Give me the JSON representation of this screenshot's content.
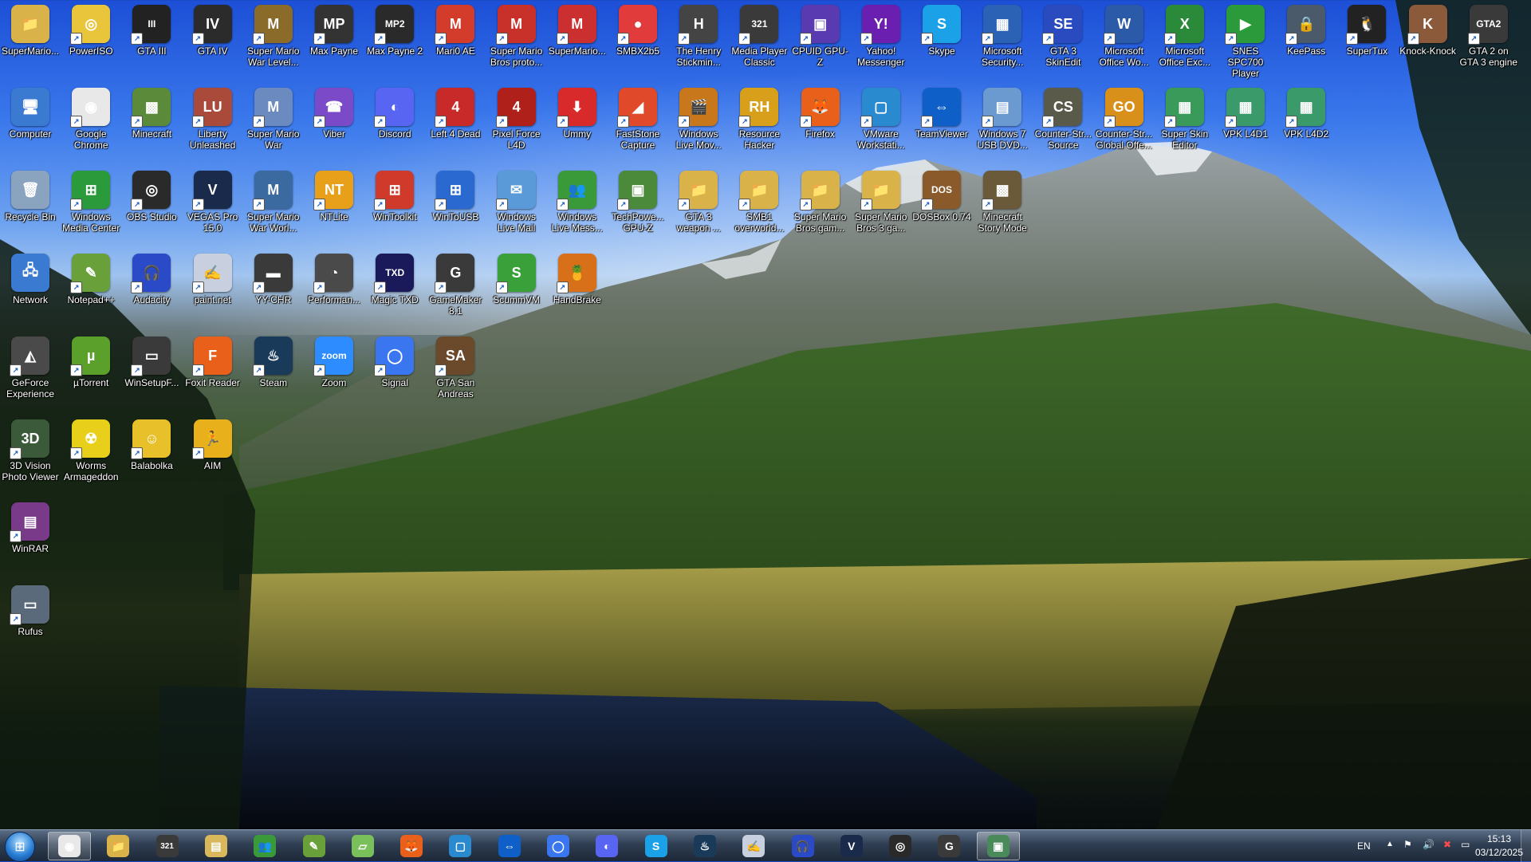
{
  "desktop": {
    "icons": [
      {
        "label": "SuperMario...",
        "icon": "folder-icon",
        "color": "#d9b34a",
        "glyph": "📁",
        "col": 0,
        "row": 0
      },
      {
        "label": "PowerISO",
        "icon": "disc-icon",
        "color": "#e8c53a",
        "glyph": "◎",
        "col": 1,
        "row": 0
      },
      {
        "label": "GTA III",
        "icon": "gta3-icon",
        "color": "#222222",
        "glyph": "III",
        "col": 2,
        "row": 0
      },
      {
        "label": "GTA IV",
        "icon": "gta4-icon",
        "color": "#2b2b2b",
        "glyph": "IV",
        "col": 3,
        "row": 0
      },
      {
        "label": "Super Mario War Level...",
        "icon": "game-icon",
        "color": "#8a6b2a",
        "glyph": "M",
        "col": 4,
        "row": 0
      },
      {
        "label": "Max Payne",
        "icon": "max-payne-icon",
        "color": "#333333",
        "glyph": "MP",
        "col": 5,
        "row": 0
      },
      {
        "label": "Max Payne 2",
        "icon": "max-payne2-icon",
        "color": "#2a2a2a",
        "glyph": "MP2",
        "col": 6,
        "row": 0
      },
      {
        "label": "Mari0 AE",
        "icon": "mario-icon",
        "color": "#d33b2a",
        "glyph": "M",
        "col": 7,
        "row": 0
      },
      {
        "label": "Super Mario Bros proto...",
        "icon": "mario-icon",
        "color": "#c8302a",
        "glyph": "M",
        "col": 8,
        "row": 0
      },
      {
        "label": "SuperMario...",
        "icon": "mario-icon",
        "color": "#cc2f2f",
        "glyph": "M",
        "col": 9,
        "row": 0
      },
      {
        "label": "SMBX2b5",
        "icon": "mushroom-icon",
        "color": "#e23b3b",
        "glyph": "●",
        "col": 10,
        "row": 0
      },
      {
        "label": "The Henry Stickmin...",
        "icon": "henry-icon",
        "color": "#444444",
        "glyph": "H",
        "col": 11,
        "row": 0
      },
      {
        "label": "Media Player Classic",
        "icon": "media-player-icon",
        "color": "#3a3a3a",
        "glyph": "321",
        "col": 12,
        "row": 0
      },
      {
        "label": "CPUID GPU-Z",
        "icon": "cpu-icon",
        "color": "#5a3ab0",
        "glyph": "▣",
        "col": 13,
        "row": 0
      },
      {
        "label": "Yahoo! Messenger",
        "icon": "yahoo-icon",
        "color": "#6a1fb0",
        "glyph": "Y!",
        "col": 14,
        "row": 0
      },
      {
        "label": "Skype",
        "icon": "skype-icon",
        "color": "#1aa1e8",
        "glyph": "S",
        "col": 15,
        "row": 0
      },
      {
        "label": "Microsoft Security...",
        "icon": "security-icon",
        "color": "#2b62b5",
        "glyph": "▦",
        "col": 16,
        "row": 0
      },
      {
        "label": "GTA 3 SkinEdit",
        "icon": "skinedit-icon",
        "color": "#2a4ac0",
        "glyph": "SE",
        "col": 17,
        "row": 0
      },
      {
        "label": "Microsoft Office Wo...",
        "icon": "word-icon",
        "color": "#2b5aa8",
        "glyph": "W",
        "col": 18,
        "row": 0
      },
      {
        "label": "Microsoft Office Exc...",
        "icon": "excel-icon",
        "color": "#2a8a3a",
        "glyph": "X",
        "col": 19,
        "row": 0
      },
      {
        "label": "SNES SPC700 Player",
        "icon": "play-icon",
        "color": "#2a9a3a",
        "glyph": "▶",
        "col": 20,
        "row": 0
      },
      {
        "label": "KeePass",
        "icon": "lock-icon",
        "color": "#4a5a6a",
        "glyph": "🔒",
        "col": 21,
        "row": 0
      },
      {
        "label": "SuperTux",
        "icon": "tux-icon",
        "color": "#222222",
        "glyph": "🐧",
        "col": 22,
        "row": 0
      },
      {
        "label": "Knock-Knock",
        "icon": "knock-icon",
        "color": "#8a5a3a",
        "glyph": "K",
        "col": 23,
        "row": 0
      },
      {
        "label": "GTA 2 on GTA 3 engine",
        "icon": "gta2-icon",
        "color": "#3a3a3a",
        "glyph": "GTA2",
        "col": 24,
        "row": 0
      },
      {
        "label": "Computer",
        "icon": "computer-icon",
        "color": "#3a7ad0",
        "glyph": "🖥",
        "col": 0,
        "row": 1
      },
      {
        "label": "Google Chrome",
        "icon": "chrome-icon",
        "color": "#e8e8e8",
        "glyph": "◉",
        "col": 1,
        "row": 1
      },
      {
        "label": "Minecraft",
        "icon": "minecraft-icon",
        "color": "#5a8a3a",
        "glyph": "▩",
        "col": 2,
        "row": 1
      },
      {
        "label": "Liberty Unleashed",
        "icon": "liberty-icon",
        "color": "#aa4a3a",
        "glyph": "LU",
        "col": 3,
        "row": 1
      },
      {
        "label": "Super Mario War",
        "icon": "mario-icon",
        "color": "#6a8ac0",
        "glyph": "M",
        "col": 4,
        "row": 1
      },
      {
        "label": "Viber",
        "icon": "viber-icon",
        "color": "#7a4ac8",
        "glyph": "☎",
        "col": 5,
        "row": 1
      },
      {
        "label": "Discord",
        "icon": "discord-icon",
        "color": "#5865f2",
        "glyph": "◐",
        "col": 6,
        "row": 1
      },
      {
        "label": "Left 4 Dead",
        "icon": "l4d-icon",
        "color": "#c82a2a",
        "glyph": "4",
        "col": 7,
        "row": 1
      },
      {
        "label": "Pixel Force L4D",
        "icon": "l4d-icon",
        "color": "#b0201a",
        "glyph": "4",
        "col": 8,
        "row": 1
      },
      {
        "label": "Ummy",
        "icon": "download-icon",
        "color": "#d82a2a",
        "glyph": "⬇",
        "col": 9,
        "row": 1
      },
      {
        "label": "FastStone Capture",
        "icon": "faststone-icon",
        "color": "#e04a2a",
        "glyph": "◢",
        "col": 10,
        "row": 1
      },
      {
        "label": "Windows Live Mov...",
        "icon": "movie-icon",
        "color": "#c8781a",
        "glyph": "🎬",
        "col": 11,
        "row": 1
      },
      {
        "label": "Resource Hacker",
        "icon": "reshacker-icon",
        "color": "#d8a01a",
        "glyph": "RH",
        "col": 12,
        "row": 1
      },
      {
        "label": "Firefox",
        "icon": "firefox-icon",
        "color": "#e8601a",
        "glyph": "🦊",
        "col": 13,
        "row": 1
      },
      {
        "label": "VMware Workstati...",
        "icon": "vmware-icon",
        "color": "#2a8ad0",
        "glyph": "▢",
        "col": 14,
        "row": 1
      },
      {
        "label": "TeamViewer",
        "icon": "teamviewer-icon",
        "color": "#0e5fc8",
        "glyph": "⇔",
        "col": 15,
        "row": 1
      },
      {
        "label": "Windows 7 USB DVD...",
        "icon": "usb-icon",
        "color": "#6a9ad0",
        "glyph": "▤",
        "col": 16,
        "row": 1
      },
      {
        "label": "Counter-Str... Source",
        "icon": "cs-icon",
        "color": "#5a5a4a",
        "glyph": "CS",
        "col": 17,
        "row": 1
      },
      {
        "label": "Counter-Str... Global Offe...",
        "icon": "csgo-icon",
        "color": "#d8901a",
        "glyph": "GO",
        "col": 18,
        "row": 1
      },
      {
        "label": "Super Skin Editor",
        "icon": "skin-editor-icon",
        "color": "#3a9a5a",
        "glyph": "▦",
        "col": 19,
        "row": 1
      },
      {
        "label": "VPK L4D1",
        "icon": "vpk-icon",
        "color": "#3a9a6a",
        "glyph": "▦",
        "col": 20,
        "row": 1
      },
      {
        "label": "VPK L4D2",
        "icon": "vpk-icon",
        "color": "#3a9a6a",
        "glyph": "▦",
        "col": 21,
        "row": 1
      },
      {
        "label": "Recycle Bin",
        "icon": "recycle-bin-icon",
        "color": "#8aa4c0",
        "glyph": "🗑",
        "col": 0,
        "row": 2
      },
      {
        "label": "Windows Media Center",
        "icon": "media-center-icon",
        "color": "#2a9a3a",
        "glyph": "⊞",
        "col": 1,
        "row": 2
      },
      {
        "label": "OBS Studio",
        "icon": "obs-icon",
        "color": "#2a2a2a",
        "glyph": "◎",
        "col": 2,
        "row": 2
      },
      {
        "label": "VEGAS Pro 15.0",
        "icon": "vegas-icon",
        "color": "#1a2a4a",
        "glyph": "V",
        "col": 3,
        "row": 2
      },
      {
        "label": "Super Mario War Worl...",
        "icon": "mario-icon",
        "color": "#3a6aa0",
        "glyph": "M",
        "col": 4,
        "row": 2
      },
      {
        "label": "NTLite",
        "icon": "ntlite-icon",
        "color": "#e8a01a",
        "glyph": "NT",
        "col": 5,
        "row": 2
      },
      {
        "label": "WinToolkit",
        "icon": "wintoolkit-icon",
        "color": "#d03a2a",
        "glyph": "⊞",
        "col": 6,
        "row": 2
      },
      {
        "label": "WinToUSB",
        "icon": "wintousb-icon",
        "color": "#2a6ad0",
        "glyph": "⊞",
        "col": 7,
        "row": 2
      },
      {
        "label": "Windows Live Mail",
        "icon": "mail-icon",
        "color": "#5a9ad8",
        "glyph": "✉",
        "col": 8,
        "row": 2
      },
      {
        "label": "Windows Live Mess...",
        "icon": "messenger-icon",
        "color": "#3a9a3a",
        "glyph": "👥",
        "col": 9,
        "row": 2
      },
      {
        "label": "TechPowe... GPU-Z",
        "icon": "gpuz-icon",
        "color": "#4a8a3a",
        "glyph": "▣",
        "col": 10,
        "row": 2
      },
      {
        "label": "GTA 3 weapon ...",
        "icon": "folder-icon",
        "color": "#d9b34a",
        "glyph": "📁",
        "col": 11,
        "row": 2
      },
      {
        "label": "SMB1 overworld...",
        "icon": "folder-icon",
        "color": "#d9b34a",
        "glyph": "📁",
        "col": 12,
        "row": 2
      },
      {
        "label": "Super Mario Bros gam...",
        "icon": "folder-icon",
        "color": "#d9b34a",
        "glyph": "📁",
        "col": 13,
        "row": 2
      },
      {
        "label": "Super Mario Bros 3 ga...",
        "icon": "folder-icon",
        "color": "#d9b34a",
        "glyph": "📁",
        "col": 14,
        "row": 2
      },
      {
        "label": "DOSBox 0.74",
        "icon": "dosbox-icon",
        "color": "#8a5a2a",
        "glyph": "DOS",
        "col": 15,
        "row": 2
      },
      {
        "label": "Minecraft Story Mode",
        "icon": "minecraft-icon",
        "color": "#6a5a3a",
        "glyph": "▩",
        "col": 16,
        "row": 2
      },
      {
        "label": "Network",
        "icon": "network-icon",
        "color": "#3a7ad0",
        "glyph": "🖧",
        "col": 0,
        "row": 3
      },
      {
        "label": "Notepad++",
        "icon": "notepad-icon",
        "color": "#6aa03a",
        "glyph": "✎",
        "col": 1,
        "row": 3
      },
      {
        "label": "Audacity",
        "icon": "audacity-icon",
        "color": "#2a4ac8",
        "glyph": "🎧",
        "col": 2,
        "row": 3
      },
      {
        "label": "paint.net",
        "icon": "paint-icon",
        "color": "#c8d0e0",
        "glyph": "✍",
        "col": 3,
        "row": 3
      },
      {
        "label": "YY-CHR",
        "icon": "chip-icon",
        "color": "#3a3a3a",
        "glyph": "▬",
        "col": 4,
        "row": 3
      },
      {
        "label": "Performan...",
        "icon": "performance-icon",
        "color": "#4a4a4a",
        "glyph": "◔",
        "col": 5,
        "row": 3
      },
      {
        "label": "Magic TXD",
        "icon": "magic-txd-icon",
        "color": "#1a1a5a",
        "glyph": "TXD",
        "col": 6,
        "row": 3
      },
      {
        "label": "GameMaker 8.1",
        "icon": "gamemaker-icon",
        "color": "#3a3a3a",
        "glyph": "G",
        "col": 7,
        "row": 3
      },
      {
        "label": "ScummVM",
        "icon": "scummvm-icon",
        "color": "#3aa03a",
        "glyph": "S",
        "col": 8,
        "row": 3
      },
      {
        "label": "HandBrake",
        "icon": "handbrake-icon",
        "color": "#d8701a",
        "glyph": "🍍",
        "col": 9,
        "row": 3
      },
      {
        "label": "GeForce Experience",
        "icon": "nvidia-icon",
        "color": "#4a4a4a",
        "glyph": "◭",
        "col": 0,
        "row": 4
      },
      {
        "label": "µTorrent",
        "icon": "utorrent-icon",
        "color": "#5aa02a",
        "glyph": "µ",
        "col": 1,
        "row": 4
      },
      {
        "label": "WinSetupF...",
        "icon": "usb-stick-icon",
        "color": "#3a3a3a",
        "glyph": "▭",
        "col": 2,
        "row": 4
      },
      {
        "label": "Foxit Reader",
        "icon": "foxit-icon",
        "color": "#e8601a",
        "glyph": "F",
        "col": 3,
        "row": 4
      },
      {
        "label": "Steam",
        "icon": "steam-icon",
        "color": "#1a3a5a",
        "glyph": "♨",
        "col": 4,
        "row": 4
      },
      {
        "label": "Zoom",
        "icon": "zoom-icon",
        "color": "#2d8cff",
        "glyph": "zoom",
        "col": 5,
        "row": 4
      },
      {
        "label": "Signal",
        "icon": "signal-icon",
        "color": "#3a76f0",
        "glyph": "◯",
        "col": 6,
        "row": 4
      },
      {
        "label": "GTA San Andreas",
        "icon": "gta-sa-icon",
        "color": "#6a4a2a",
        "glyph": "SA",
        "col": 7,
        "row": 4
      },
      {
        "label": "3D Vision Photo Viewer",
        "icon": "3d-vision-icon",
        "color": "#3a5a3a",
        "glyph": "3D",
        "col": 0,
        "row": 5
      },
      {
        "label": "Worms Armageddon",
        "icon": "radiation-icon",
        "color": "#e8d01a",
        "glyph": "☢",
        "col": 1,
        "row": 5
      },
      {
        "label": "Balabolka",
        "icon": "balabolka-icon",
        "color": "#e8c02a",
        "glyph": "☺",
        "col": 2,
        "row": 5
      },
      {
        "label": "AIM",
        "icon": "aim-icon",
        "color": "#e8b01a",
        "glyph": "🏃",
        "col": 3,
        "row": 5
      },
      {
        "label": "WinRAR",
        "icon": "winrar-icon",
        "color": "#7a3a8a",
        "glyph": "▤",
        "col": 0,
        "row": 6
      },
      {
        "label": "Rufus",
        "icon": "rufus-icon",
        "color": "#5a6a7a",
        "glyph": "▭",
        "col": 0,
        "row": 7
      }
    ]
  },
  "taskbar": {
    "items": [
      {
        "name": "chrome",
        "icon": "chrome-icon",
        "color": "#e8e8e8",
        "glyph": "◉",
        "active": true
      },
      {
        "name": "explorer",
        "icon": "folder-icon",
        "color": "#d9b34a",
        "glyph": "📁",
        "active": false
      },
      {
        "name": "media-player-classic",
        "icon": "media-player-icon",
        "color": "#3a3a3a",
        "glyph": "321",
        "active": false
      },
      {
        "name": "file-manager",
        "icon": "files-icon",
        "color": "#d8b85a",
        "glyph": "▤",
        "active": false
      },
      {
        "name": "messenger",
        "icon": "messenger-icon",
        "color": "#3a9a3a",
        "glyph": "👥",
        "active": false
      },
      {
        "name": "notepad-plus-plus",
        "icon": "notepad-icon",
        "color": "#6aa03a",
        "glyph": "✎",
        "active": false
      },
      {
        "name": "notepad",
        "icon": "document-icon",
        "color": "#7ac05a",
        "glyph": "▱",
        "active": false
      },
      {
        "name": "firefox",
        "icon": "firefox-icon",
        "color": "#e8601a",
        "glyph": "🦊",
        "active": false
      },
      {
        "name": "vmware",
        "icon": "vmware-icon",
        "color": "#2a8ad0",
        "glyph": "▢",
        "active": false
      },
      {
        "name": "teamviewer",
        "icon": "teamviewer-icon",
        "color": "#0e5fc8",
        "glyph": "⇔",
        "active": false
      },
      {
        "name": "signal",
        "icon": "signal-icon",
        "color": "#3a76f0",
        "glyph": "◯",
        "active": false
      },
      {
        "name": "discord",
        "icon": "discord-icon",
        "color": "#5865f2",
        "glyph": "◐",
        "active": false
      },
      {
        "name": "skype",
        "icon": "skype-icon",
        "color": "#1aa1e8",
        "glyph": "S",
        "active": false
      },
      {
        "name": "steam",
        "icon": "steam-icon",
        "color": "#1a3a5a",
        "glyph": "♨",
        "active": false
      },
      {
        "name": "paint-net",
        "icon": "paint-icon",
        "color": "#c8d0e0",
        "glyph": "✍",
        "active": false
      },
      {
        "name": "audacity",
        "icon": "audacity-icon",
        "color": "#2a4ac8",
        "glyph": "🎧",
        "active": false
      },
      {
        "name": "vegas-pro",
        "icon": "vegas-icon",
        "color": "#1a2a4a",
        "glyph": "V",
        "active": false
      },
      {
        "name": "obs-studio",
        "icon": "obs-icon",
        "color": "#2a2a2a",
        "glyph": "◎",
        "active": false
      },
      {
        "name": "gamemaker",
        "icon": "gamemaker-icon",
        "color": "#3a3a3a",
        "glyph": "G",
        "active": false
      },
      {
        "name": "desktop-window",
        "icon": "window-icon",
        "color": "#4a8a5a",
        "glyph": "▣",
        "active": true
      }
    ],
    "tray": {
      "language": "EN",
      "time": "15:13",
      "date": "03/12/2025"
    }
  }
}
